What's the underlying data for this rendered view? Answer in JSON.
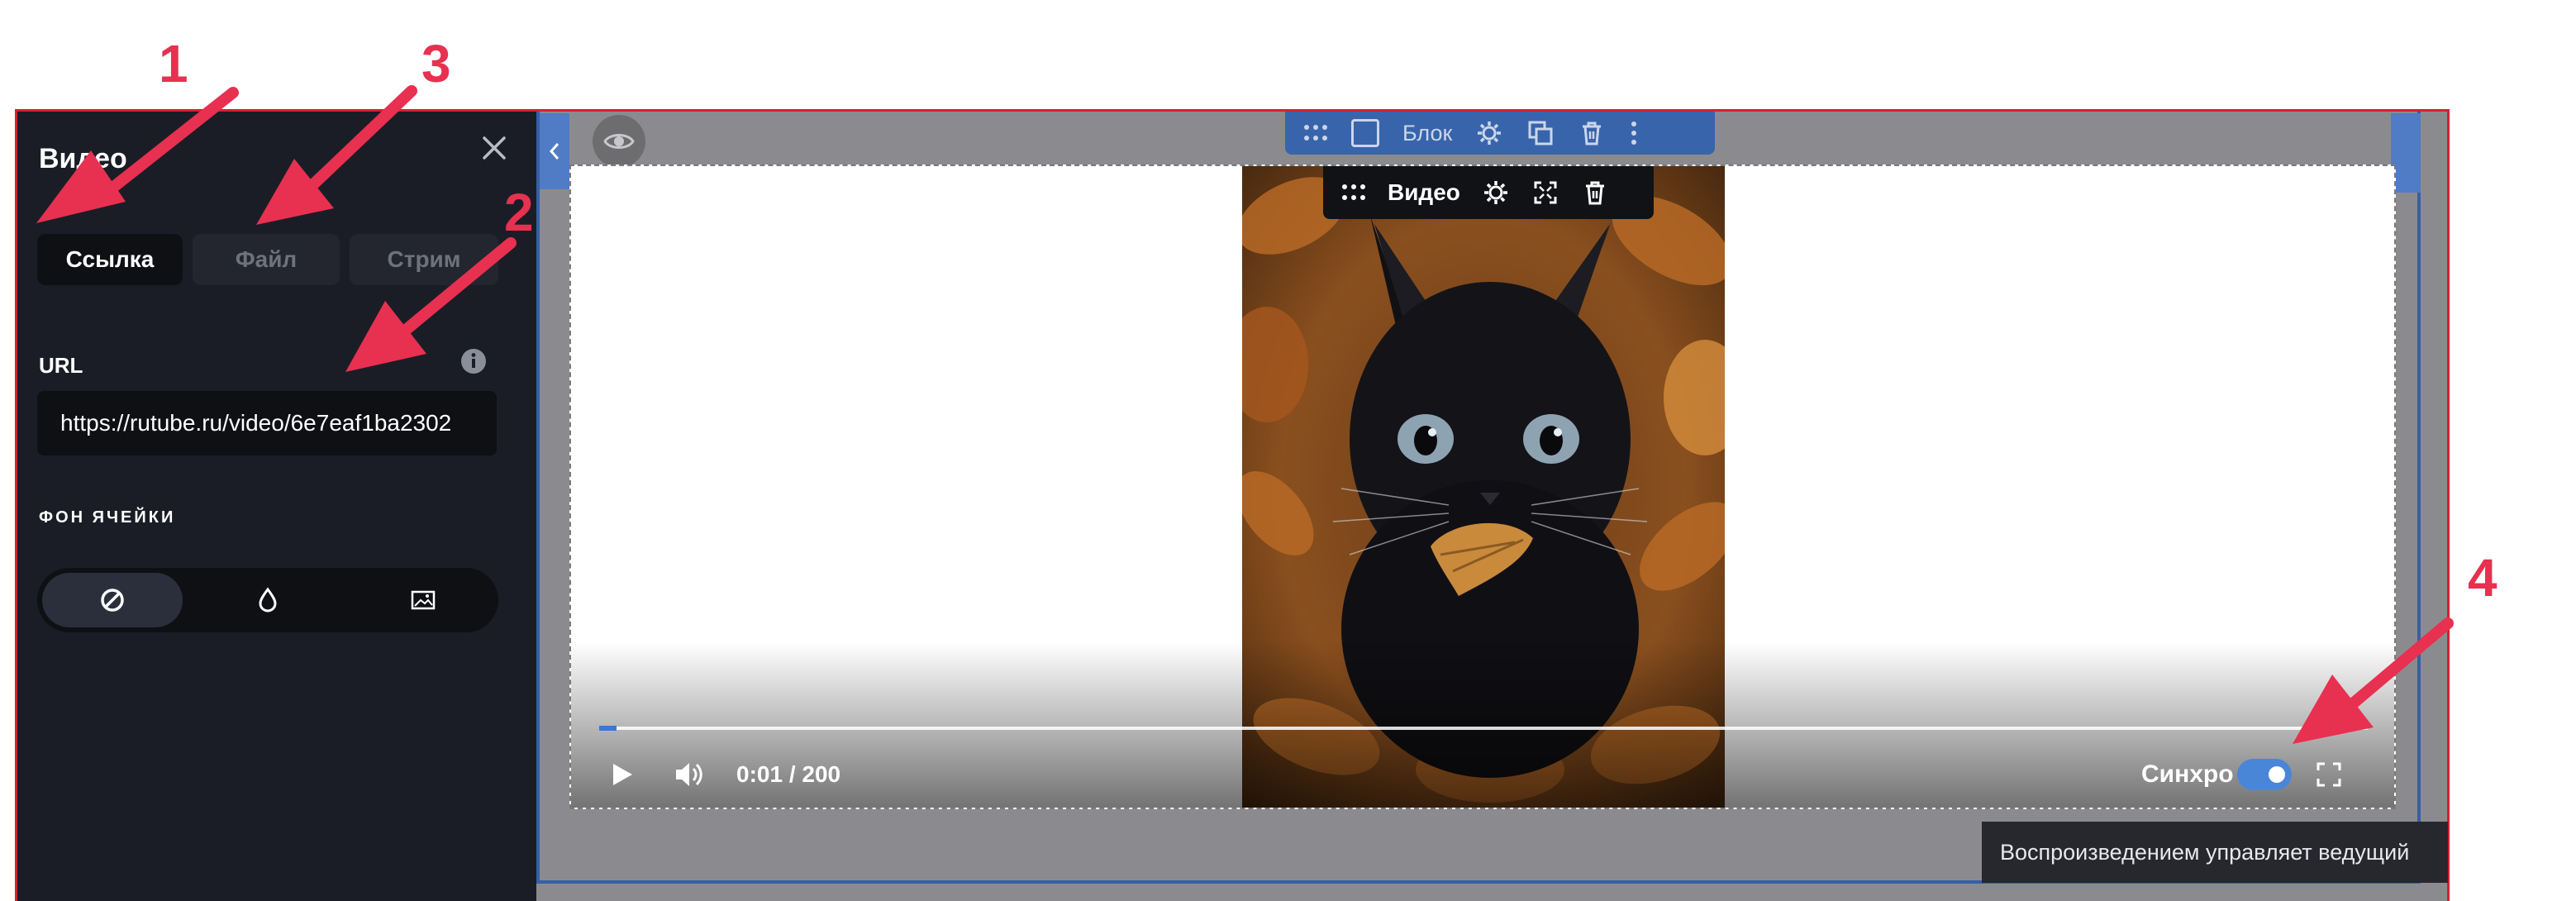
{
  "panel": {
    "title": "Видео",
    "tabs": [
      {
        "label": "Ссылка",
        "active": true
      },
      {
        "label": "Файл",
        "active": false
      },
      {
        "label": "Стрим",
        "active": false
      }
    ],
    "url_label": "URL",
    "url_value": "https://rutube.ru/video/6e7eaf1ba2302",
    "bg_label": "ФОН ЯЧЕЙКИ",
    "bg_options": [
      {
        "icon": "none-icon",
        "active": true
      },
      {
        "icon": "drop-icon",
        "active": false
      },
      {
        "icon": "image-icon",
        "active": false
      }
    ]
  },
  "block_toolbar": {
    "label": "Блок",
    "icons": [
      "drag-handle-icon",
      "checkbox",
      "gear-icon",
      "copy-icon",
      "trash-icon",
      "more-icon"
    ]
  },
  "video_toolbar": {
    "label": "Видео",
    "icons": [
      "drag-handle-icon",
      "gear-icon",
      "expand-icon",
      "trash-icon"
    ]
  },
  "player": {
    "time": "0:01 / 200",
    "progress": 0.006,
    "sync_label": "Синхро",
    "sync_on": true
  },
  "tooltip": "Воспроизведением управляет ведущий",
  "markers": [
    "1",
    "2",
    "3",
    "4"
  ],
  "colors": {
    "accent": "#3864ac",
    "annotation": "#e83050",
    "panel_bg": "#1b1d26",
    "toggle": "#4a86d8"
  }
}
